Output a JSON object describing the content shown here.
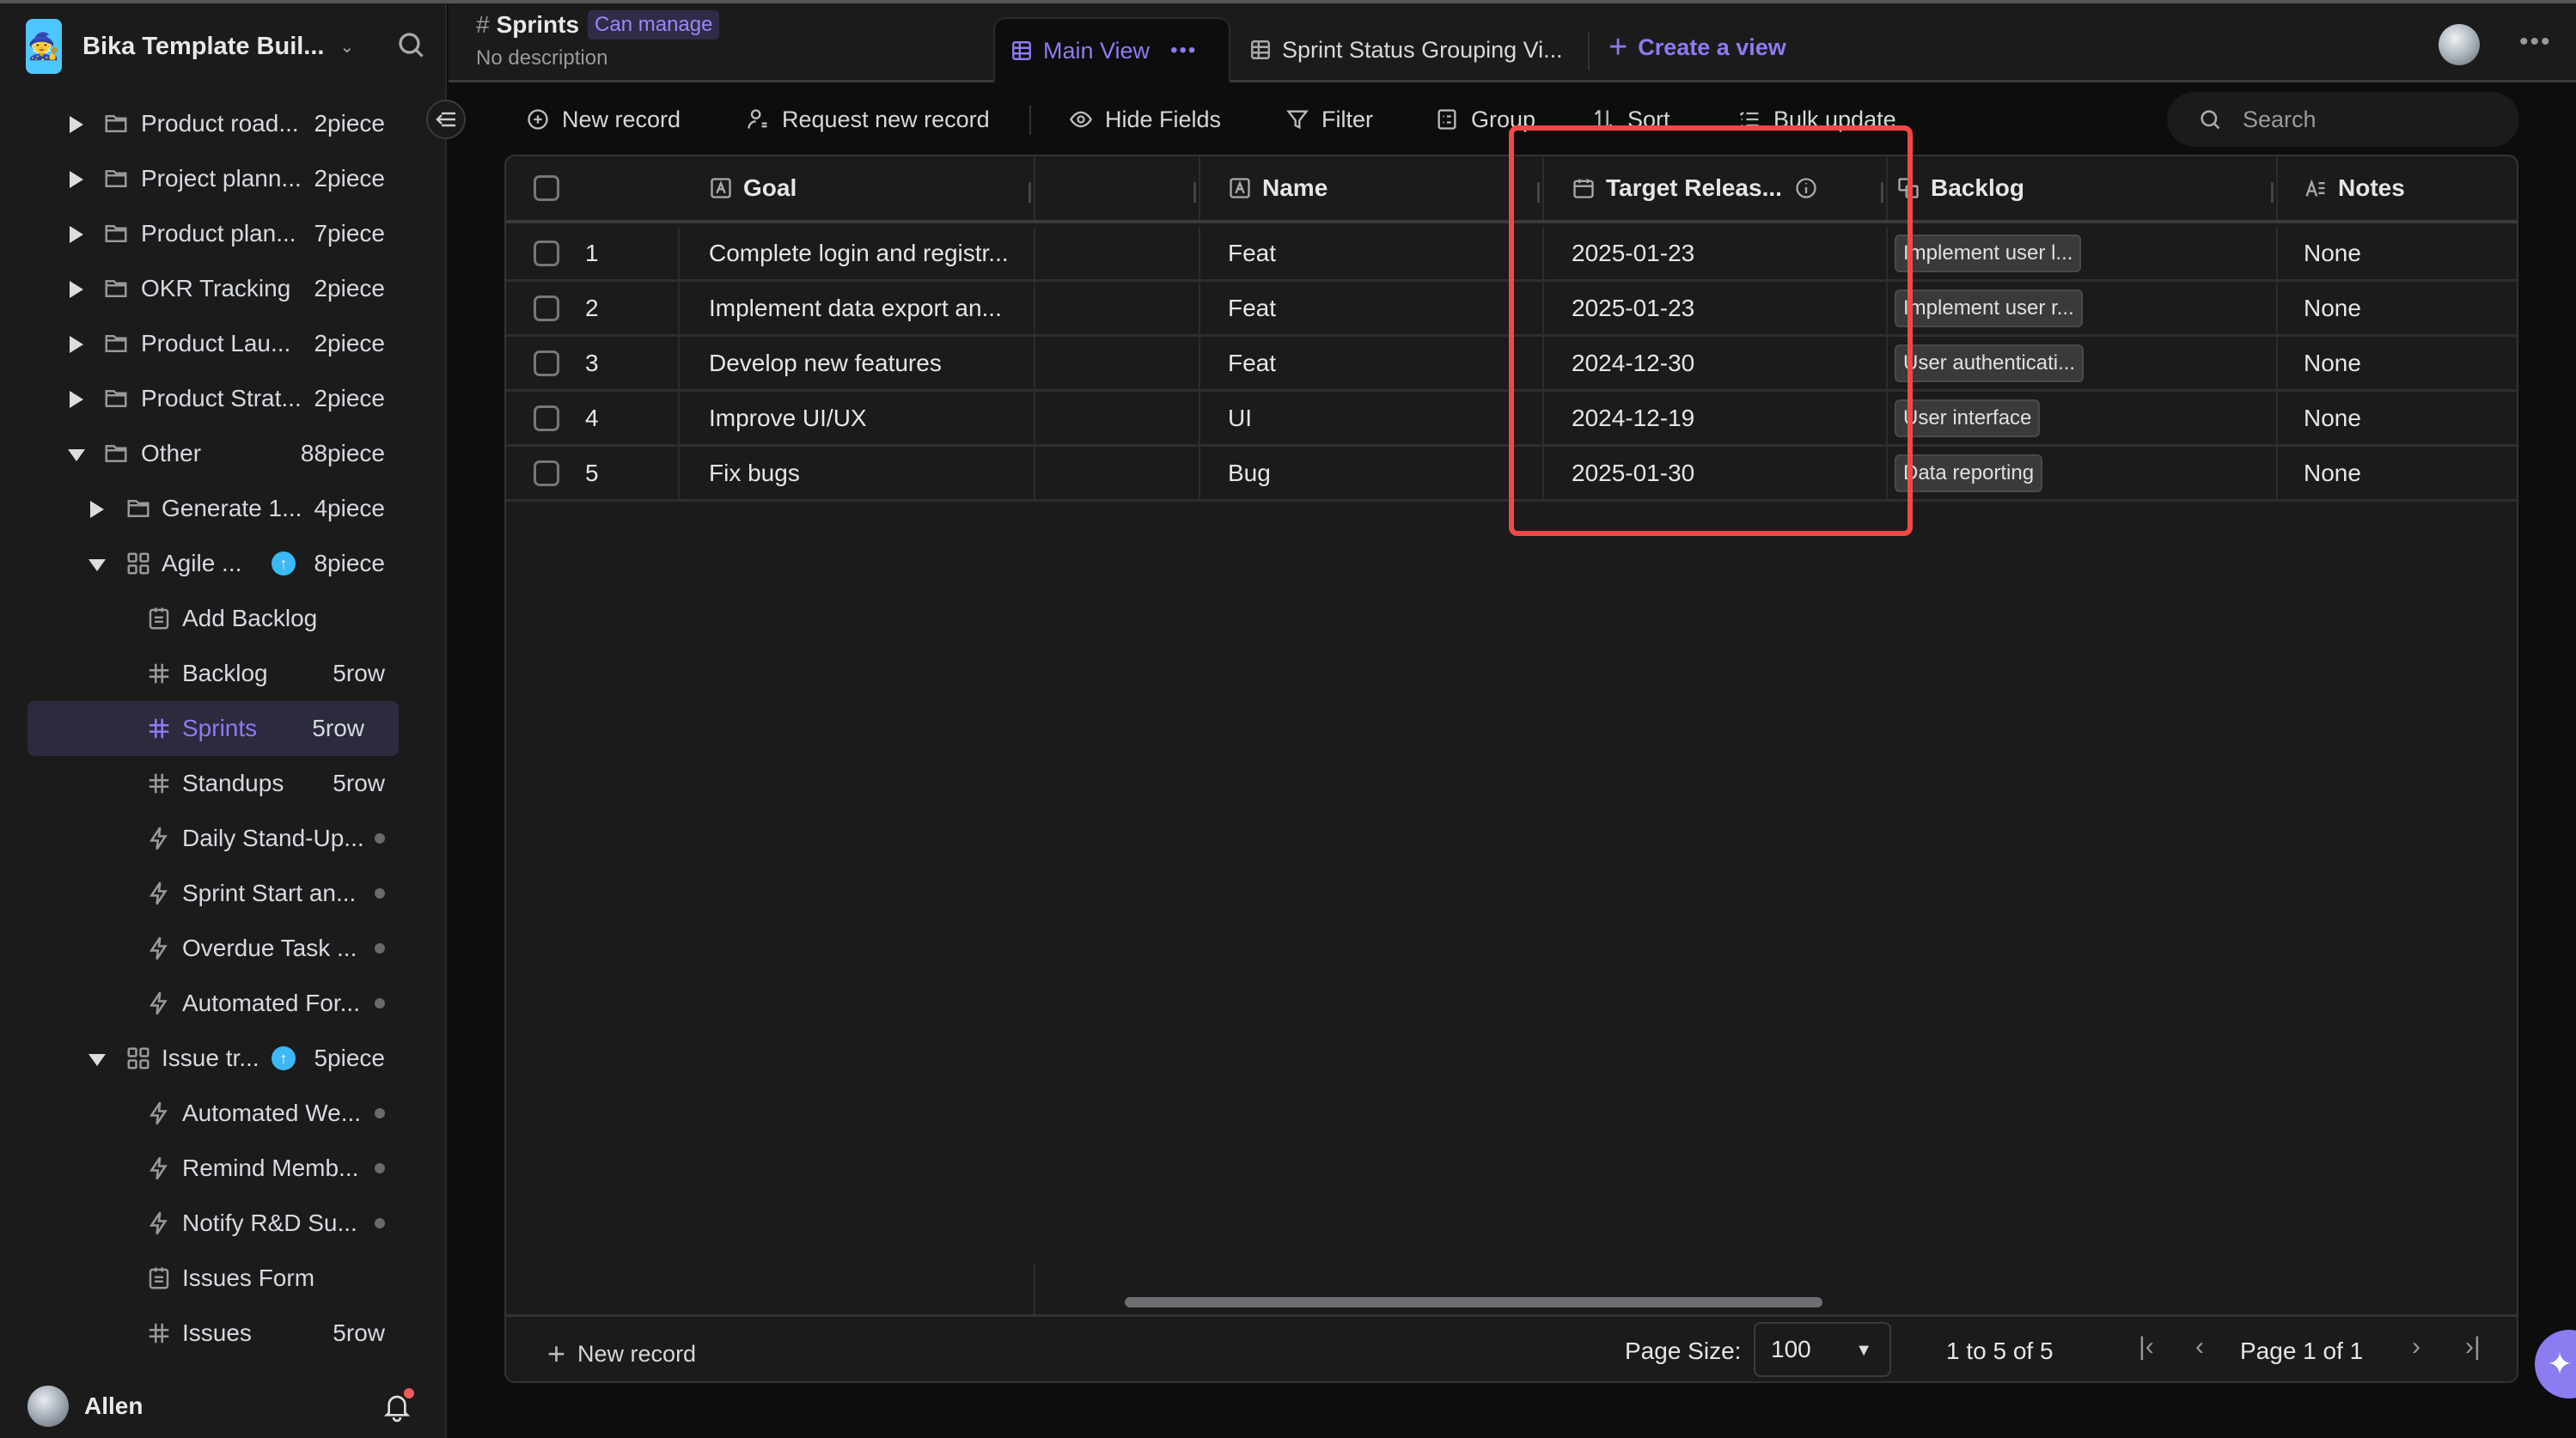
{
  "workspace": {
    "name": "Bika Template Buil...",
    "logo": "wizard-emoji"
  },
  "sidebar": {
    "items": [
      {
        "label": "Product road...",
        "count": "2piece",
        "type": "folder",
        "expanded": false,
        "depth": 0
      },
      {
        "label": "Project plann...",
        "count": "2piece",
        "type": "folder",
        "expanded": false,
        "depth": 0
      },
      {
        "label": "Product plan...",
        "count": "7piece",
        "type": "folder",
        "expanded": false,
        "depth": 0
      },
      {
        "label": "OKR Tracking",
        "count": "2piece",
        "type": "folder",
        "expanded": false,
        "depth": 0
      },
      {
        "label": "Product Lau...",
        "count": "2piece",
        "type": "folder",
        "expanded": false,
        "depth": 0
      },
      {
        "label": "Product Strat...",
        "count": "2piece",
        "type": "folder",
        "expanded": false,
        "depth": 0
      },
      {
        "label": "Other",
        "count": "88piece",
        "type": "folder",
        "expanded": true,
        "depth": 0
      },
      {
        "label": "Generate 1...",
        "count": "4piece",
        "type": "folder",
        "expanded": false,
        "depth": 1
      },
      {
        "label": "Agile ...",
        "count": "8piece",
        "type": "template",
        "expanded": true,
        "depth": 1,
        "upgrade_badge": true
      },
      {
        "label": "Add Backlog",
        "count": "",
        "type": "form",
        "depth": 2
      },
      {
        "label": "Backlog",
        "count": "5row",
        "type": "datasheet",
        "depth": 2
      },
      {
        "label": "Sprints",
        "count": "5row",
        "type": "datasheet",
        "depth": 2,
        "active": true
      },
      {
        "label": "Standups",
        "count": "5row",
        "type": "datasheet",
        "depth": 2
      },
      {
        "label": "Daily Stand-Up...",
        "count": "",
        "type": "automation",
        "depth": 2,
        "status_dot": true
      },
      {
        "label": "Sprint Start an...",
        "count": "",
        "type": "automation",
        "depth": 2,
        "status_dot": true
      },
      {
        "label": "Overdue Task ...",
        "count": "",
        "type": "automation",
        "depth": 2,
        "status_dot": true
      },
      {
        "label": "Automated For...",
        "count": "",
        "type": "automation",
        "depth": 2,
        "status_dot": true
      },
      {
        "label": "Issue tr...",
        "count": "5piece",
        "type": "template",
        "expanded": true,
        "depth": 1,
        "upgrade_badge": true
      },
      {
        "label": "Automated We...",
        "count": "",
        "type": "automation",
        "depth": 2,
        "status_dot": true
      },
      {
        "label": "Remind Memb...",
        "count": "",
        "type": "automation",
        "depth": 2,
        "status_dot": true
      },
      {
        "label": "Notify R&D Su...",
        "count": "",
        "type": "automation",
        "depth": 2,
        "status_dot": true
      },
      {
        "label": "Issues Form",
        "count": "",
        "type": "form",
        "depth": 2
      },
      {
        "label": "Issues",
        "count": "5row",
        "type": "datasheet",
        "depth": 2
      }
    ],
    "user": {
      "name": "Allen"
    }
  },
  "header": {
    "title": "Sprints",
    "permission": "Can manage",
    "description": "No description",
    "tabs": [
      {
        "label": "Main View",
        "active": true
      },
      {
        "label": "Sprint Status Grouping Vi...",
        "active": false
      }
    ],
    "create_view": "Create a view"
  },
  "toolbar": {
    "new_record": "New record",
    "request_new_record": "Request new record",
    "hide_fields": "Hide Fields",
    "filter": "Filter",
    "group": "Group",
    "sort": "Sort",
    "bulk_update": "Bulk update",
    "search_placeholder": "Search"
  },
  "table": {
    "columns": [
      {
        "label": "Goal",
        "type": "text"
      },
      {
        "label": "",
        "type": "blank"
      },
      {
        "label": "Name",
        "type": "text"
      },
      {
        "label": "Target Releas...",
        "type": "date",
        "has_info": true
      },
      {
        "label": "Backlog",
        "type": "link"
      },
      {
        "label": "Notes",
        "type": "long-text"
      }
    ],
    "rows": [
      {
        "index": "1",
        "goal": "Complete login and registr...",
        "name": "Feat",
        "target": "2025-01-23",
        "backlog": "Implement user l...",
        "notes": "None"
      },
      {
        "index": "2",
        "goal": "Implement data export an...",
        "name": "Feat",
        "target": "2025-01-23",
        "backlog": "Implement user r...",
        "notes": "None"
      },
      {
        "index": "3",
        "goal": "Develop new features",
        "name": "Feat",
        "target": "2024-12-30",
        "backlog": "User authenticati...",
        "notes": "None"
      },
      {
        "index": "4",
        "goal": "Improve UI/UX",
        "name": "UI",
        "target": "2024-12-19",
        "backlog": "User interface",
        "notes": "None"
      },
      {
        "index": "5",
        "goal": "Fix bugs",
        "name": "Bug",
        "target": "2025-01-30",
        "backlog": "Data reporting",
        "notes": "None"
      }
    ],
    "footer": {
      "new_record": "New record",
      "page_size_label": "Page Size:",
      "page_size": "100",
      "range": "1 to 5 of 5",
      "page": "Page 1 of 1"
    }
  },
  "colors": {
    "accent": "#8e7bf0",
    "highlight": "#f04848",
    "badge_blue": "#3bb8f5",
    "background": "#0d0d0d",
    "panel": "#1b1b1b"
  }
}
